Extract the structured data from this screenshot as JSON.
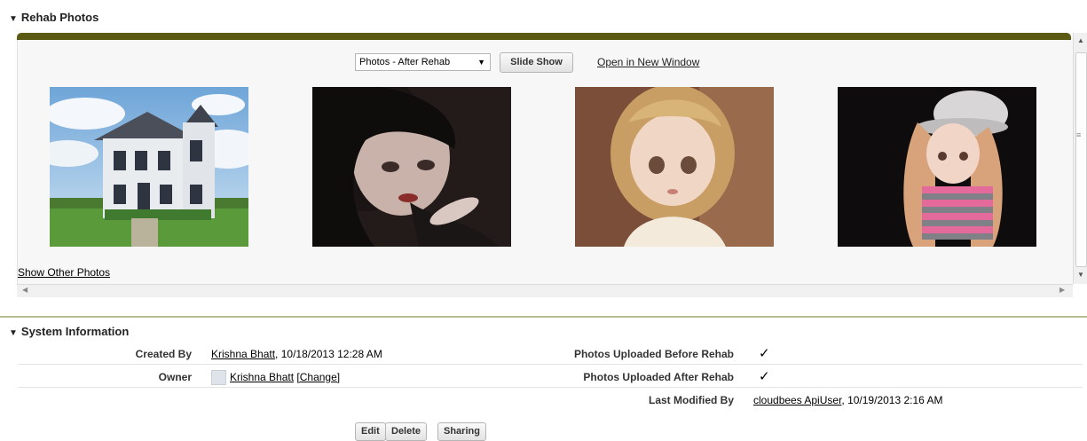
{
  "rehab_section": {
    "title": "Rehab Photos",
    "select_value": "Photos - After Rehab",
    "slide_show_label": "Slide Show",
    "open_window_label": "Open in New Window",
    "show_other_label": "Show Other Photos"
  },
  "system_section": {
    "title": "System Information",
    "created_by_label": "Created By",
    "created_by_name": "Krishna Bhatt",
    "created_by_date": ", 10/18/2013 12:28 AM",
    "owner_label": "Owner",
    "owner_name": "Krishna Bhatt",
    "owner_change": "[Change]",
    "before_label": "Photos Uploaded Before Rehab",
    "before_value": "✓",
    "after_label": "Photos Uploaded After Rehab",
    "after_value": "✓",
    "modified_label": "Last Modified By",
    "modified_name": "cloudbees ApiUser",
    "modified_date": ", 10/19/2013 2:16 AM"
  },
  "buttons": {
    "edit": "Edit",
    "delete": "Delete",
    "sharing": "Sharing"
  },
  "colors": {
    "panel_bar": "#5b5a12",
    "divider": "#b9bd94"
  }
}
